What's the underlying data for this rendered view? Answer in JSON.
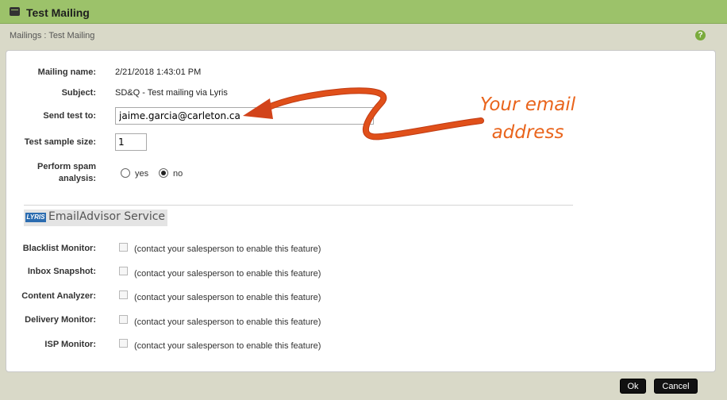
{
  "window": {
    "title": "Test Mailing"
  },
  "breadcrumb": "Mailings : Test Mailing",
  "form": {
    "mailing_name_label": "Mailing name:",
    "mailing_name_value": "2/21/2018 1:43:01 PM",
    "subject_label": "Subject:",
    "subject_value": "SD&Q - Test mailing via Lyris",
    "send_test_label": "Send test to:",
    "send_test_value": "jaime.garcia@carleton.ca",
    "sample_size_label": "Test sample size:",
    "sample_size_value": "1",
    "spam_label_line1": "Perform spam",
    "spam_label_line2": "analysis:",
    "spam_yes_label": "yes",
    "spam_no_label": "no",
    "spam_selected": "no"
  },
  "email_advisor": {
    "logo_text": "LYRIS",
    "title": "EmailAdvisor Service",
    "features": [
      {
        "label": "Blacklist Monitor:",
        "note": "(contact your salesperson to enable this feature)"
      },
      {
        "label": "Inbox Snapshot:",
        "note": "(contact your salesperson to enable this feature)"
      },
      {
        "label": "Content Analyzer:",
        "note": "(contact your salesperson to enable this feature)"
      },
      {
        "label": "Delivery Monitor:",
        "note": "(contact your salesperson to enable this feature)"
      },
      {
        "label": "ISP Monitor:",
        "note": "(contact your salesperson to enable this feature)"
      }
    ]
  },
  "annotation": {
    "line1": "Your email",
    "line2": "address",
    "color": "#e9641c"
  },
  "buttons": {
    "ok": "Ok",
    "cancel": "Cancel"
  },
  "icons": {
    "window": "window-icon",
    "help": "help-icon"
  },
  "colors": {
    "titlebar": "#9cc26a",
    "background": "#d9d9c8"
  }
}
